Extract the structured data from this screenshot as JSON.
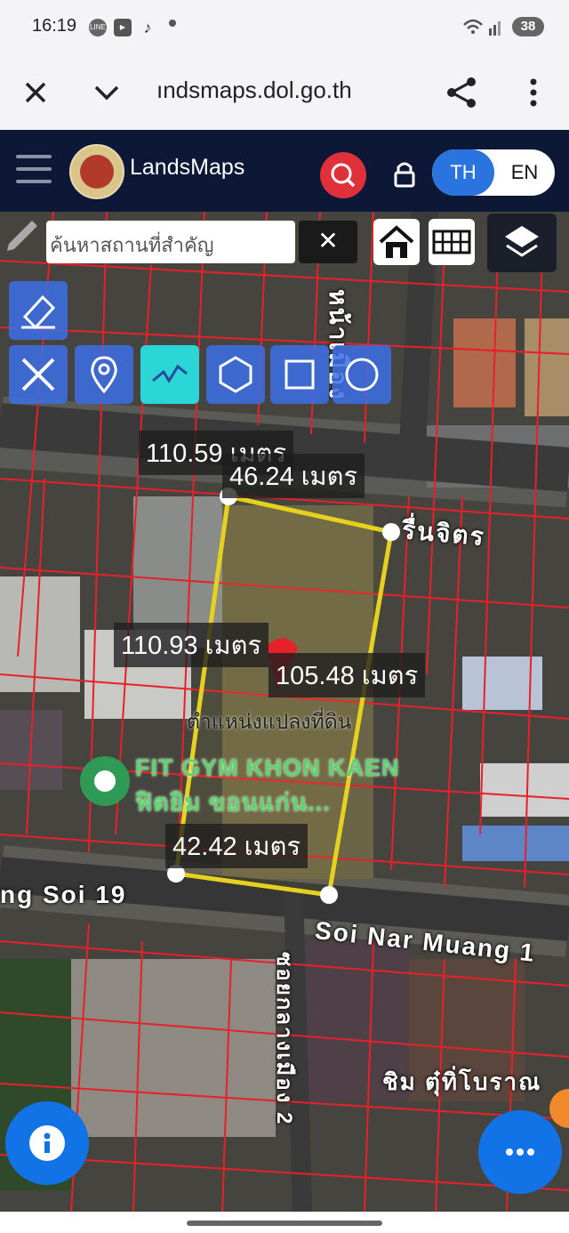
{
  "status_bar": {
    "time": "16:19",
    "apps": [
      "LINE",
      "YouTube",
      "TikTok"
    ],
    "battery": "38"
  },
  "browser": {
    "url": "ındsmaps.dol.go.th",
    "icons": [
      "close-icon",
      "chevron-down-icon",
      "share-icon",
      "more-vertical-icon"
    ]
  },
  "header": {
    "brand": "LandsMaps",
    "lang_th": "TH",
    "lang_en": "EN",
    "accent": "#2a74e0",
    "bg": "#0d1836",
    "search_color": "#e0303a"
  },
  "map_search": {
    "placeholder": "ค้นหาสถานที่สำคัญ"
  },
  "measurements": {
    "m1": "110.59 เมตร",
    "m2": "46.24 เมตร",
    "m3": "110.93 เมตร",
    "m4": "105.48 เมตร",
    "m5": "42.42 เมตร"
  },
  "map_labels": {
    "parcel_position": "ตำแหน่งแปลงที่ดิน",
    "poi_name_en": "FIT GYM KHON KAEN",
    "poi_name_th": "ฟิตยิม ขอนแก่น...",
    "street_soi19": "ng Soi 19",
    "street_soi_nar": "Soi Nar Muang 1",
    "street_vertical_top": "หน้าเมือง",
    "street_runjit": "รื่นจิตร",
    "street_vertical_bottom": "ซอยกลางเมือง 2",
    "shop": "ชิม ตุ๋ทิ่โบราณ"
  }
}
